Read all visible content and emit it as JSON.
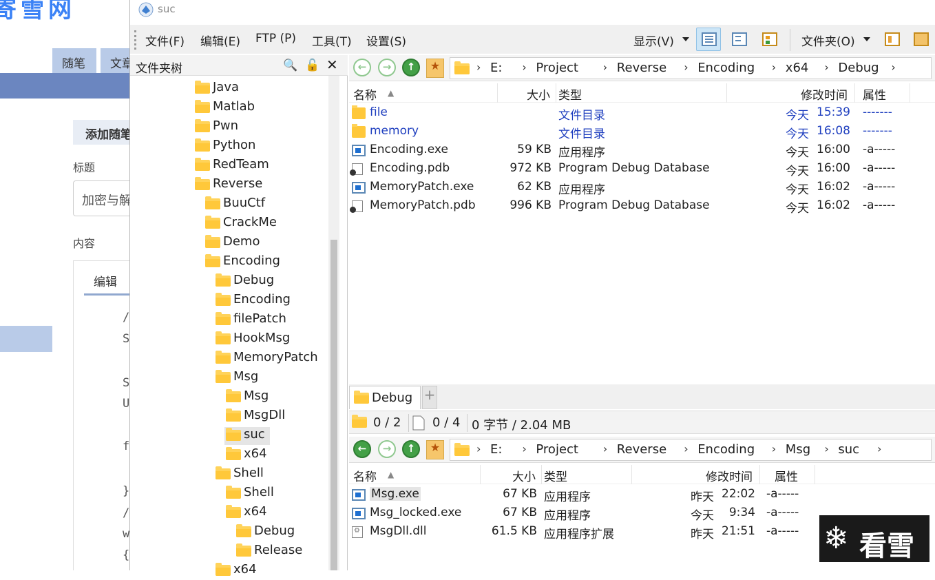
{
  "background_page": {
    "tabs": [
      "随笔",
      "文章"
    ],
    "section": "添加随笔",
    "title_label": "标题",
    "title_value": "加密与解",
    "content_label": "内容",
    "editor_tab": "编辑",
    "code_lines": [
      "/",
      "S",
      "S",
      "U",
      "f",
      "}",
      "/",
      "w",
      "{"
    ]
  },
  "window": {
    "title": "suc",
    "menu": {
      "file": "文件(F)",
      "edit": "编辑(E)",
      "ftp": "FTP (P)",
      "tools": "工具(T)",
      "settings": "设置(S)",
      "display": "显示(V)",
      "folders": "文件夹(O)"
    }
  },
  "tree": {
    "header": "文件夹树",
    "items": [
      {
        "label": "Java",
        "depth": 0
      },
      {
        "label": "Matlab",
        "depth": 0
      },
      {
        "label": "Pwn",
        "depth": 0
      },
      {
        "label": "Python",
        "depth": 0
      },
      {
        "label": "RedTeam",
        "depth": 0
      },
      {
        "label": "Reverse",
        "depth": 0
      },
      {
        "label": "BuuCtf",
        "depth": 1
      },
      {
        "label": "CrackMe",
        "depth": 1
      },
      {
        "label": "Demo",
        "depth": 1
      },
      {
        "label": "Encoding",
        "depth": 1
      },
      {
        "label": "Debug",
        "depth": 2
      },
      {
        "label": "Encoding",
        "depth": 2
      },
      {
        "label": "filePatch",
        "depth": 2
      },
      {
        "label": "HookMsg",
        "depth": 2
      },
      {
        "label": "MemoryPatch",
        "depth": 2
      },
      {
        "label": "Msg",
        "depth": 2
      },
      {
        "label": "Msg",
        "depth": 3
      },
      {
        "label": "MsgDll",
        "depth": 3
      },
      {
        "label": "suc",
        "depth": 3,
        "selected": true
      },
      {
        "label": "x64",
        "depth": 3
      },
      {
        "label": "Shell",
        "depth": 2
      },
      {
        "label": "Shell",
        "depth": 3
      },
      {
        "label": "x64",
        "depth": 3
      },
      {
        "label": "Debug",
        "depth": 4
      },
      {
        "label": "Release",
        "depth": 4
      },
      {
        "label": "x64",
        "depth": 2
      }
    ]
  },
  "top_pane": {
    "path": [
      "E:",
      "Project",
      "Reverse",
      "Encoding",
      "x64",
      "Debug"
    ],
    "columns": {
      "name": "名称",
      "size": "大小",
      "type": "类型",
      "modified": "修改时间",
      "attr": "属性"
    },
    "rows": [
      {
        "icon": "dir",
        "name": "file",
        "size": "",
        "type": "文件目录",
        "day": "今天",
        "time": "15:39",
        "attr": "-------"
      },
      {
        "icon": "dir",
        "name": "memory",
        "size": "",
        "type": "文件目录",
        "day": "今天",
        "time": "16:08",
        "attr": "-------"
      },
      {
        "icon": "exe",
        "name": "Encoding.exe",
        "size": "59 KB",
        "type": "应用程序",
        "day": "今天",
        "time": "16:00",
        "attr": "-a-----"
      },
      {
        "icon": "pdb",
        "name": "Encoding.pdb",
        "size": "972 KB",
        "type": "Program Debug Database",
        "day": "今天",
        "time": "16:00",
        "attr": "-a-----"
      },
      {
        "icon": "exe",
        "name": "MemoryPatch.exe",
        "size": "62 KB",
        "type": "应用程序",
        "day": "今天",
        "time": "16:02",
        "attr": "-a-----"
      },
      {
        "icon": "pdb",
        "name": "MemoryPatch.pdb",
        "size": "996 KB",
        "type": "Program Debug Database",
        "day": "今天",
        "time": "16:02",
        "attr": "-a-----"
      }
    ],
    "tab_label": "Debug",
    "status": {
      "folders": "0 / 2",
      "files": "0 / 4",
      "bytes": "0 字节 / 2.04 MB"
    }
  },
  "bottom_pane": {
    "path": [
      "E:",
      "Project",
      "Reverse",
      "Encoding",
      "Msg",
      "suc"
    ],
    "columns": {
      "name": "名称",
      "size": "大小",
      "type": "类型",
      "modified": "修改时间",
      "attr": "属性"
    },
    "rows": [
      {
        "icon": "exe",
        "name": "Msg.exe",
        "size": "67 KB",
        "type": "应用程序",
        "day": "昨天",
        "time": "22:02",
        "attr": "-a-----",
        "highlight": true
      },
      {
        "icon": "exe",
        "name": "Msg_locked.exe",
        "size": "67 KB",
        "type": "应用程序",
        "day": "今天",
        "time": "9:34",
        "attr": "-a-----"
      },
      {
        "icon": "dll",
        "name": "MsgDll.dll",
        "size": "61.5 KB",
        "type": "应用程序扩展",
        "day": "昨天",
        "time": "21:51",
        "attr": "-a-----"
      }
    ]
  },
  "watermark": "看雪",
  "colors": {
    "dir_text": "#1f3fbf",
    "folder": "#ffc83a",
    "accent": "#5a87b5",
    "nav_green": "#43a047"
  }
}
